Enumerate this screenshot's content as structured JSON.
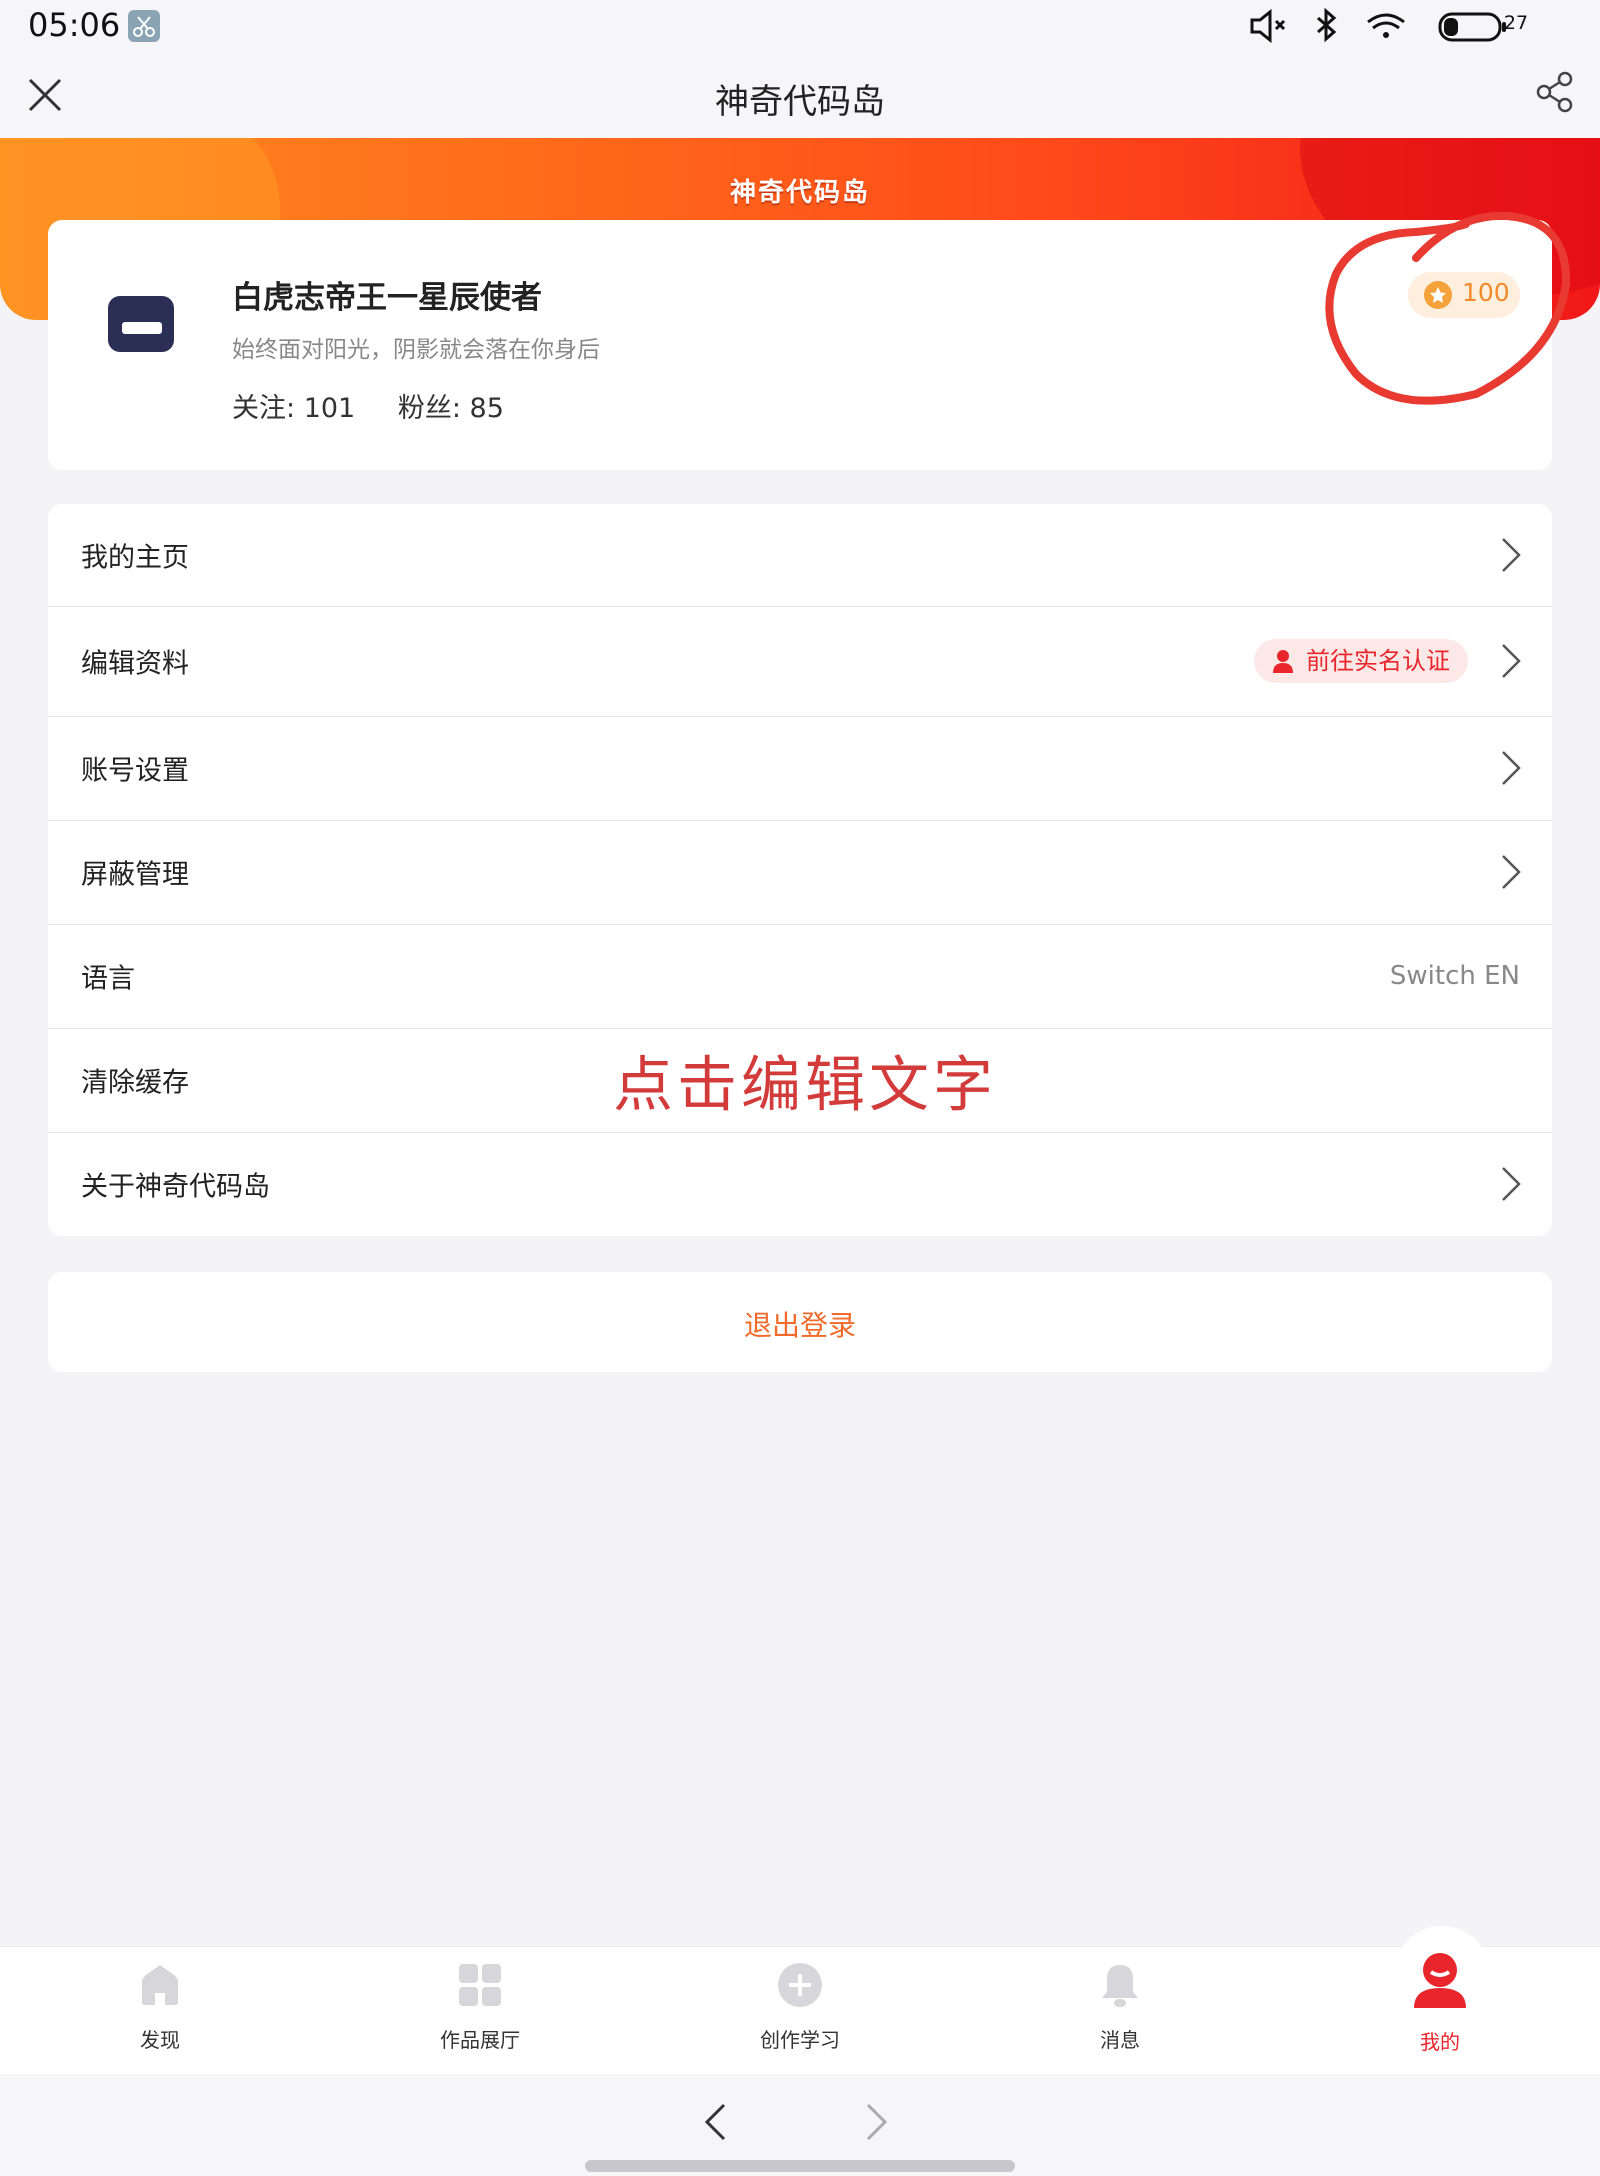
{
  "status_bar": {
    "time": "05:06",
    "battery": "27"
  },
  "header": {
    "title": "神奇代码岛"
  },
  "banner": {
    "logo_text": "神奇代码岛"
  },
  "profile": {
    "username": "白虎志帝王一星辰使者",
    "signature": "始终面对阳光，阴影就会落在你身后",
    "following_label": "关注",
    "following_count": "101",
    "followers_label": "粉丝",
    "followers_count": "85",
    "points": "100"
  },
  "menu": {
    "items": [
      {
        "label": "我的主页"
      },
      {
        "label": "编辑资料",
        "badge": "前往实名认证"
      },
      {
        "label": "账号设置"
      },
      {
        "label": "屏蔽管理"
      },
      {
        "label": "语言",
        "value": "Switch EN"
      },
      {
        "label": "清除缓存",
        "annotation": "点击编辑文字"
      },
      {
        "label": "关于神奇代码岛"
      }
    ]
  },
  "logout": {
    "label": "退出登录"
  },
  "tabs": [
    {
      "label": "发现",
      "icon": "home-icon"
    },
    {
      "label": "作品展厅",
      "icon": "grid-icon"
    },
    {
      "label": "创作学习",
      "icon": "plus-circle-icon"
    },
    {
      "label": "消息",
      "icon": "bell-icon"
    },
    {
      "label": "我的",
      "icon": "user-icon",
      "active": true
    }
  ],
  "colors": {
    "accent": "#f26a2a",
    "active_red": "#e8262b",
    "banner_start": "#ff8a1f",
    "banner_end": "#f01818"
  }
}
